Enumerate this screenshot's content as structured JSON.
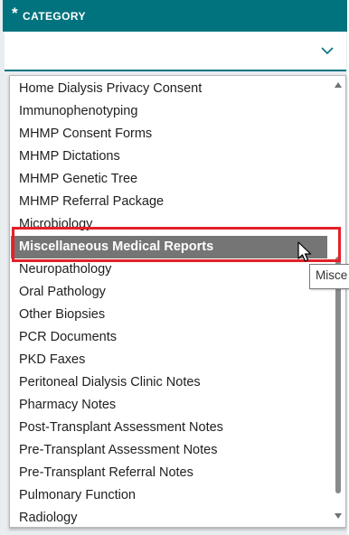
{
  "header": {
    "required_marker": "*",
    "title": "CATEGORY"
  },
  "select": {
    "value": "",
    "icon": "chevron-down-icon"
  },
  "dropdown": {
    "items": [
      "Home Dialysis Privacy Consent",
      "Immunophenotyping",
      "MHMP Consent Forms",
      "MHMP Dictations",
      "MHMP Genetic Tree",
      "MHMP Referral Package",
      "Microbiology",
      "Miscellaneous Medical Reports",
      "Neuropathology",
      "Oral Pathology",
      "Other Biopsies",
      "PCR Documents",
      "PKD Faxes",
      "Peritoneal Dialysis Clinic Notes",
      "Pharmacy Notes",
      "Post-Transplant Assessment Notes",
      "Pre-Transplant Assessment Notes",
      "Pre-Transplant Referral Notes",
      "Pulmonary Function",
      "Radiology"
    ],
    "selected_index": 7,
    "tooltip": "Misce"
  },
  "colors": {
    "header_bg": "#00737e",
    "selected_bg": "#757575",
    "highlight_border": "#e32028"
  }
}
